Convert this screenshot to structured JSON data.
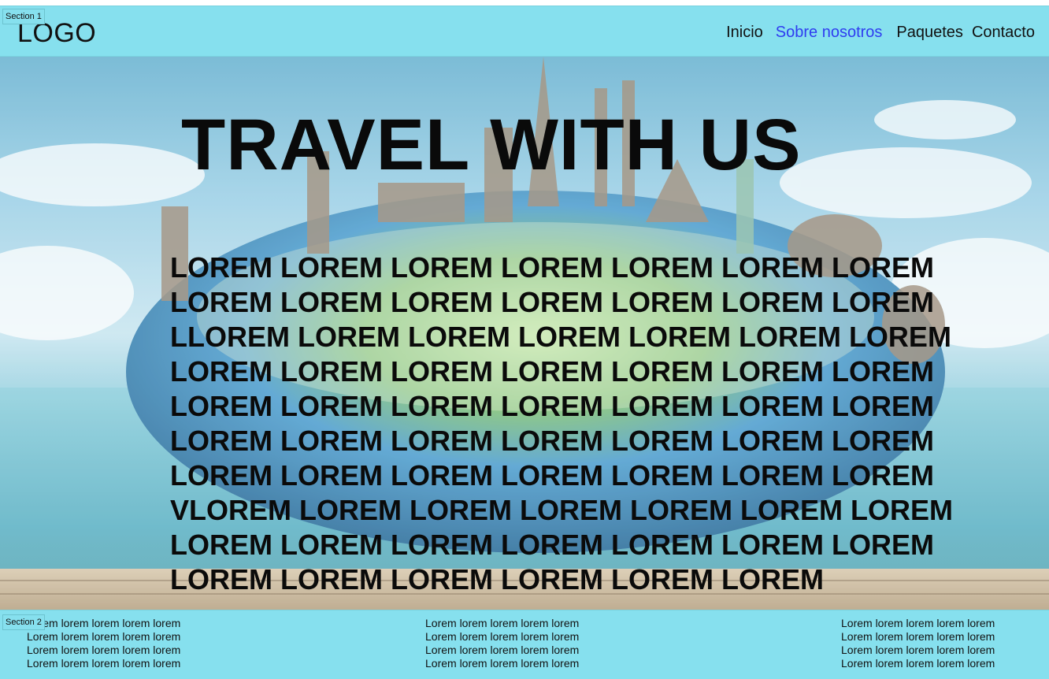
{
  "header": {
    "section_label": "Section 1",
    "logo": "LOGO",
    "nav": [
      {
        "label": "Inicio",
        "active": false
      },
      {
        "label": "Sobre nosotros",
        "active": true
      },
      {
        "label": "Paquetes",
        "active": false
      },
      {
        "label": "Contacto",
        "active": false
      }
    ]
  },
  "hero": {
    "title": "TRAVEL WITH US",
    "lines": [
      "LOREM LOREM LOREM LOREM LOREM LOREM LOREM",
      "LOREM LOREM LOREM LOREM LOREM LOREM LOREM",
      "LLOREM LOREM LOREM LOREM LOREM LOREM LOREM",
      "LOREM LOREM LOREM LOREM LOREM LOREM LOREM",
      "LOREM LOREM LOREM LOREM LOREM LOREM LOREM",
      "LOREM LOREM LOREM LOREM LOREM LOREM LOREM",
      "LOREM LOREM LOREM LOREM LOREM LOREM LOREM",
      "VLOREM LOREM LOREM LOREM LOREM LOREM LOREM",
      "LOREM LOREM LOREM LOREM LOREM LOREM LOREM",
      "LOREM LOREM LOREM LOREM LOREM LOREM"
    ]
  },
  "footer": {
    "section_label": "Section 2",
    "columns": [
      {
        "lines": [
          "Lorem lorem lorem lorem lorem",
          "Lorem lorem lorem lorem lorem",
          "Lorem lorem lorem lorem lorem",
          "Lorem lorem lorem lorem lorem"
        ]
      },
      {
        "lines": [
          "Lorem lorem lorem lorem lorem",
          "Lorem lorem lorem lorem lorem",
          "Lorem lorem lorem lorem lorem",
          "Lorem lorem lorem lorem lorem"
        ]
      },
      {
        "lines": [
          "Lorem lorem lorem lorem lorem",
          "Lorem lorem lorem lorem lorem",
          "Lorem lorem lorem lorem lorem",
          "Lorem lorem lorem lorem lorem"
        ]
      }
    ]
  },
  "colors": {
    "section_bg": "#86e0ee",
    "nav_active": "#2f3cf0",
    "text": "#111111"
  }
}
